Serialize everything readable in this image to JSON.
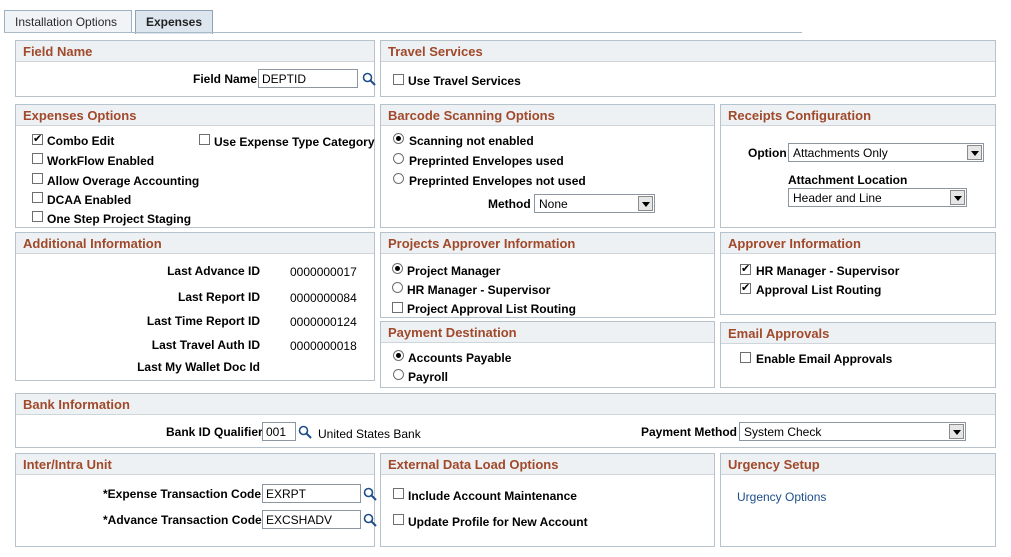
{
  "tabs": {
    "installation": "Installation Options",
    "expenses": "Expenses"
  },
  "field_name": {
    "title": "Field Name",
    "label": "Field Name",
    "value": "DEPTID"
  },
  "travel": {
    "title": "Travel Services",
    "use_travel": "Use Travel Services"
  },
  "expenses_options": {
    "title": "Expenses Options",
    "combo_edit": "Combo Edit",
    "use_expense_type": "Use Expense Type Category",
    "workflow": "WorkFlow Enabled",
    "allow_overage": "Allow Overage Accounting",
    "dcaa": "DCAA Enabled",
    "one_step": "One Step Project Staging"
  },
  "barcode": {
    "title": "Barcode Scanning Options",
    "opt1": "Scanning not enabled",
    "opt2": "Preprinted Envelopes used",
    "opt3": "Preprinted Envelopes not used",
    "method_label": "Method",
    "method_value": "None"
  },
  "receipts": {
    "title": "Receipts Configuration",
    "option_label": "Option",
    "option_value": "Attachments Only",
    "attach_label": "Attachment Location",
    "attach_value": "Header and Line"
  },
  "additional": {
    "title": "Additional Information",
    "rows": [
      {
        "label": "Last Advance ID",
        "value": "0000000017"
      },
      {
        "label": "Last Report ID",
        "value": "0000000084"
      },
      {
        "label": "Last Time Report ID",
        "value": "0000000124"
      },
      {
        "label": "Last Travel Auth ID",
        "value": "0000000018"
      },
      {
        "label": "Last My Wallet Doc Id",
        "value": ""
      }
    ]
  },
  "projects_approver": {
    "title": "Projects Approver Information",
    "pm": "Project Manager",
    "hr": "HR Manager - Supervisor",
    "routing": "Project Approval List Routing"
  },
  "approver": {
    "title": "Approver Information",
    "hr": "HR Manager - Supervisor",
    "routing": "Approval List Routing"
  },
  "payment_dest": {
    "title": "Payment Destination",
    "ap": "Accounts Payable",
    "payroll": "Payroll"
  },
  "email": {
    "title": "Email Approvals",
    "enable": "Enable Email Approvals"
  },
  "bank": {
    "title": "Bank Information",
    "qualifier_label": "Bank ID Qualifier",
    "qualifier_value": "001",
    "bank_name": "United States Bank",
    "method_label": "Payment Method",
    "method_value": "System Check"
  },
  "inter": {
    "title": "Inter/Intra Unit",
    "exp_label": "*Expense Transaction Code",
    "exp_value": "EXRPT",
    "adv_label": "*Advance Transaction Code",
    "adv_value": "EXCSHADV"
  },
  "external": {
    "title": "External Data Load Options",
    "include": "Include Account Maintenance",
    "update": "Update Profile for New Account"
  },
  "urgency": {
    "title": "Urgency Setup",
    "link": "Urgency Options"
  }
}
